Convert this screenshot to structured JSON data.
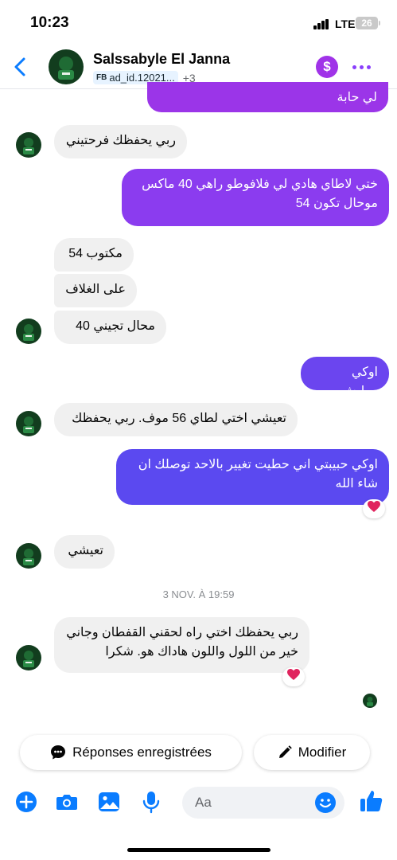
{
  "status_bar": {
    "time": "10:23",
    "network": "LTE",
    "battery": "26"
  },
  "header": {
    "contact_name": "Salssabyle El Janna",
    "ad_prefix": "FB",
    "ad_id": "ad_id.12021...",
    "extra_count": "+3",
    "dollar_symbol": "$"
  },
  "colors": {
    "accent": "#0a7cff",
    "outgoing_top": "#9b35e8",
    "outgoing_bottom": "#5b49f0",
    "reaction_heart": "#e0245e"
  },
  "messages": [
    {
      "dir": "out",
      "text": "لي حابة"
    },
    {
      "dir": "in",
      "text": "ربي يحفظك فرحتيني"
    },
    {
      "dir": "out",
      "text": "ختي لاطاي هادي لي فلافوطو راهي 40 ماكس موحال تكون 54"
    },
    {
      "dir": "in",
      "text": "مكتوب 54"
    },
    {
      "dir": "in",
      "text": "على الغلاف"
    },
    {
      "dir": "in",
      "text": "محال تجيني 40"
    },
    {
      "dir": "out",
      "text": "اوكي معليش"
    },
    {
      "dir": "in",
      "text": "تعيشي اختي لطاي 56 موف. ربي يحفظك"
    },
    {
      "dir": "out",
      "text": "اوكي حبيبتي اني حطيت تغيير بالاحد توصلك ان شاء الله",
      "reaction": "heart"
    },
    {
      "dir": "in",
      "text": "تعيشي"
    },
    {
      "dir": "in",
      "text": "ربي يحفظك اختي راه لحقني القفطان وجاني خير من اللول واللون هاداك هو. شكرا",
      "reaction": "heart"
    }
  ],
  "timestamp_divider": "3 NOV. À 19:59",
  "quick_replies": {
    "saved_replies": "Réponses enregistrées",
    "edit": "Modifier"
  },
  "composer": {
    "placeholder": "Aa"
  },
  "icons": [
    "back-icon",
    "dollar-icon",
    "more-icon",
    "plus-icon",
    "camera-icon",
    "gallery-icon",
    "microphone-icon",
    "emoji-icon",
    "thumbs-up-icon",
    "message-icon",
    "pencil-icon",
    "heart-icon"
  ]
}
